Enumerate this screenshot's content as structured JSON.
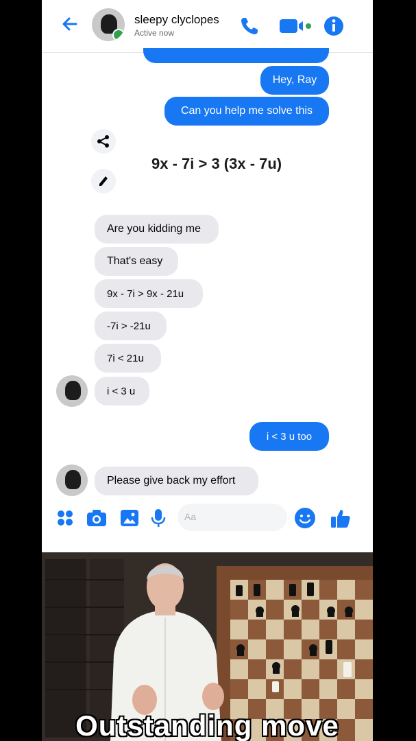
{
  "header": {
    "contact_name": "sleepy clyclopes",
    "status": "Active now",
    "colors": {
      "accent": "#1877f2",
      "online": "#31a24c"
    }
  },
  "messages": {
    "sent_1": "Hey, Ray",
    "sent_2": "Can you help me solve this",
    "equation": "9x - 7i > 3 (3x - 7u)",
    "recv_1": "Are you kidding me",
    "recv_2": "That's easy",
    "recv_3": "9x - 7i > 9x - 21u",
    "recv_4": "-7i > -21u",
    "recv_5": "7i < 21u",
    "recv_6": "i < 3 u",
    "sent_3": "i < 3 u  too",
    "recv_7": "Please give back my effort"
  },
  "composer": {
    "placeholder": "Aa",
    "icons": [
      "apps-icon",
      "camera-icon",
      "gallery-icon",
      "mic-icon",
      "emoji-icon",
      "like-icon"
    ]
  },
  "meme": {
    "caption": "Outstanding move"
  }
}
